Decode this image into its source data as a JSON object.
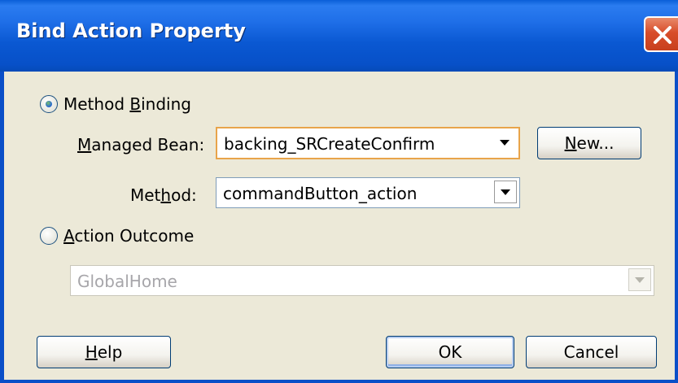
{
  "window": {
    "title": "Bind Action Property"
  },
  "method_binding": {
    "label": "Method Binding",
    "selected": true,
    "managed_bean_label": "Managed Bean:",
    "managed_bean_value": "backing_SRCreateConfirm",
    "new_button": "New...",
    "method_label": "Method:",
    "method_value": "commandButton_action"
  },
  "action_outcome": {
    "label": "Action Outcome",
    "selected": false,
    "value": "GlobalHome",
    "enabled": false
  },
  "buttons": {
    "help": "Help",
    "ok": "OK",
    "cancel": "Cancel"
  },
  "colors": {
    "titlebar": "#0a58d2",
    "dialog_bg": "#ece9d8",
    "close": "#d84d2a",
    "focus_border": "#e8a44a"
  }
}
